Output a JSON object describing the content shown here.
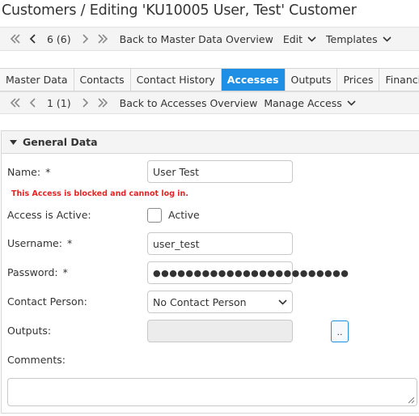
{
  "page": {
    "title": "Customers / Editing 'KU10005 User, Test' Customer"
  },
  "toolbar": {
    "first_icon": "double-chevron-left-icon",
    "prev_icon": "chevron-left-icon",
    "counter": "6 (6)",
    "next_icon": "chevron-right-icon",
    "last_icon": "double-chevron-right-icon",
    "back_label": "Back to Master Data Overview",
    "edit_label": "Edit",
    "templates_label": "Templates"
  },
  "tabs": [
    {
      "label": "Master Data",
      "active": false
    },
    {
      "label": "Contacts",
      "active": false
    },
    {
      "label": "Contact History",
      "active": false
    },
    {
      "label": "Accesses",
      "active": true
    },
    {
      "label": "Outputs",
      "active": false
    },
    {
      "label": "Prices",
      "active": false
    },
    {
      "label": "Financial Docu",
      "active": false
    }
  ],
  "subtoolbar": {
    "counter": "1 (1)",
    "back_label": "Back to Accesses Overview",
    "manage_label": "Manage Access"
  },
  "panel": {
    "title": "General Data"
  },
  "form": {
    "name_label": "Name:",
    "name_value": "User Test",
    "required_marker": "*",
    "error_message": "This Access is blocked and cannot log in.",
    "active_label": "Access is Active:",
    "active_checkbox_label": "Active",
    "active_checked": false,
    "username_label": "Username:",
    "username_value": "user_test",
    "password_label": "Password:",
    "password_value": "●●●●●●●●●●●●●●●●●●●●●●●●",
    "contact_person_label": "Contact Person:",
    "contact_person_value": "No Contact Person",
    "outputs_label": "Outputs:",
    "outputs_value": "",
    "browse_label": "..",
    "comments_label": "Comments:",
    "comments_value": ""
  },
  "colors": {
    "accent": "#1f8fe6",
    "error": "#e52525"
  }
}
